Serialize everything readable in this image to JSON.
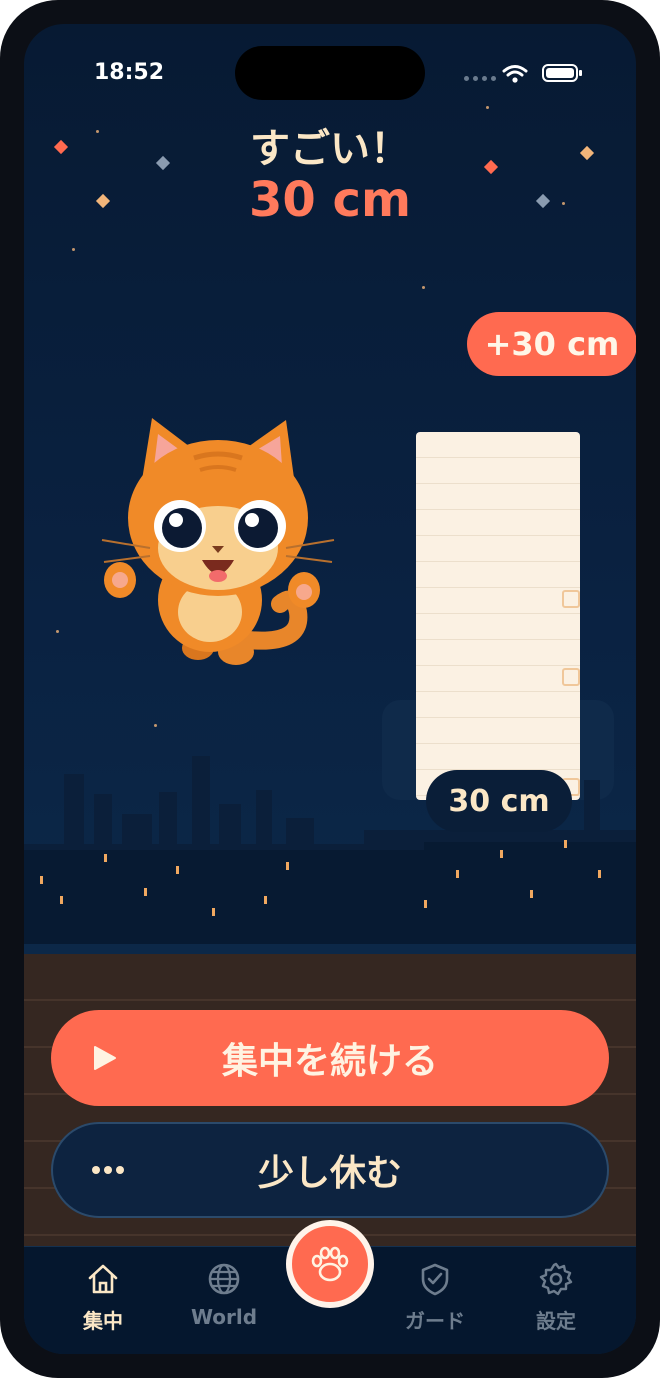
{
  "status_bar": {
    "time": "18:52"
  },
  "celebration": {
    "headline": "すごい！",
    "total": "30 cm"
  },
  "gain_badge": "+30 cm",
  "stack_label": "30 cm",
  "actions": {
    "primary": "集中を続ける",
    "secondary": "少し休む"
  },
  "tabs": [
    {
      "label": "集中",
      "icon": "home-icon",
      "active": true
    },
    {
      "label": "World",
      "icon": "globe-icon",
      "active": false
    },
    {
      "label": "ガード",
      "icon": "shield-check-icon",
      "active": false
    },
    {
      "label": "設定",
      "icon": "gear-icon",
      "active": false
    }
  ],
  "center_button_icon": "paw-icon",
  "colors": {
    "accent": "#ff6a50",
    "cream": "#fbe7c6",
    "background": "#0a2242"
  }
}
